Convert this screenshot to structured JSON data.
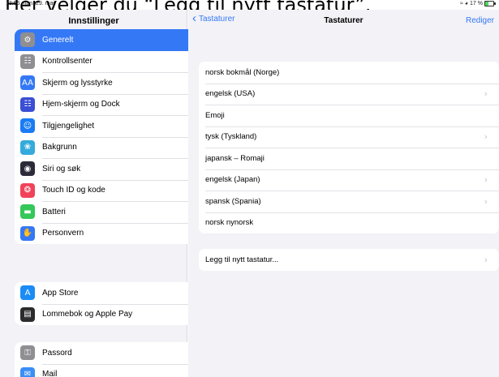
{
  "caption": "Her velger du “Legg til nytt tastatur”.",
  "status_bar": {
    "time": "13:55  man. 29. mai",
    "battery": "17 %"
  },
  "sidebar": {
    "title": "Innstillinger",
    "group1": [
      {
        "label": "Generelt",
        "icon": "gear-icon",
        "color": "#8e8e93",
        "glyph": "⚙",
        "active": true
      },
      {
        "label": "Kontrollsenter",
        "icon": "toggles-icon",
        "color": "#8e8e93",
        "glyph": "☷"
      },
      {
        "label": "Skjerm og lysstyrke",
        "icon": "display-aa-icon",
        "color": "#3478f6",
        "glyph": "AA"
      },
      {
        "label": "Hjem-skjerm og Dock",
        "icon": "home-grid-icon",
        "color": "#3b4fd4",
        "glyph": "☷"
      },
      {
        "label": "Tilgjengelighet",
        "icon": "accessibility-icon",
        "color": "#1a7cf5",
        "glyph": "☺"
      },
      {
        "label": "Bakgrunn",
        "icon": "wallpaper-icon",
        "color": "#35aadc",
        "glyph": "❀"
      },
      {
        "label": "Siri og søk",
        "icon": "siri-icon",
        "color": "#2b2b3a",
        "glyph": "◉"
      },
      {
        "label": "Touch ID og kode",
        "icon": "fingerprint-icon",
        "color": "#f0435a",
        "glyph": "❂"
      },
      {
        "label": "Batteri",
        "icon": "battery-icon",
        "color": "#34c759",
        "glyph": "▬"
      },
      {
        "label": "Personvern",
        "icon": "hand-icon",
        "color": "#3478f6",
        "glyph": "✋"
      }
    ],
    "group2": [
      {
        "label": "App Store",
        "icon": "app-store-icon",
        "color": "#1b8cf5",
        "glyph": "A"
      },
      {
        "label": "Lommebok og Apple Pay",
        "icon": "wallet-icon",
        "color": "#2c2c2e",
        "glyph": "▤"
      }
    ],
    "group3": [
      {
        "label": "Passord",
        "icon": "key-icon",
        "color": "#8e8e93",
        "glyph": "⚿"
      },
      {
        "label": "Mail",
        "icon": "mail-icon",
        "color": "#3a8ef6",
        "glyph": "✉"
      }
    ]
  },
  "detail": {
    "back_label": "Tastaturer",
    "title": "Tastaturer",
    "edit_label": "Rediger",
    "keyboards": [
      {
        "label": "norsk bokmål (Norge)",
        "chevron": false
      },
      {
        "label": "engelsk (USA)",
        "chevron": true
      },
      {
        "label": "Emoji",
        "chevron": false
      },
      {
        "label": "tysk (Tyskland)",
        "chevron": true
      },
      {
        "label": "japansk – Romaji",
        "chevron": false
      },
      {
        "label": "engelsk (Japan)",
        "chevron": true
      },
      {
        "label": "spansk (Spania)",
        "chevron": true
      },
      {
        "label": "norsk nynorsk",
        "chevron": false
      }
    ],
    "add_keyboard": "Legg til nytt tastatur..."
  },
  "colors": {
    "accent": "#3478f6",
    "background": "#f2f2f7"
  }
}
